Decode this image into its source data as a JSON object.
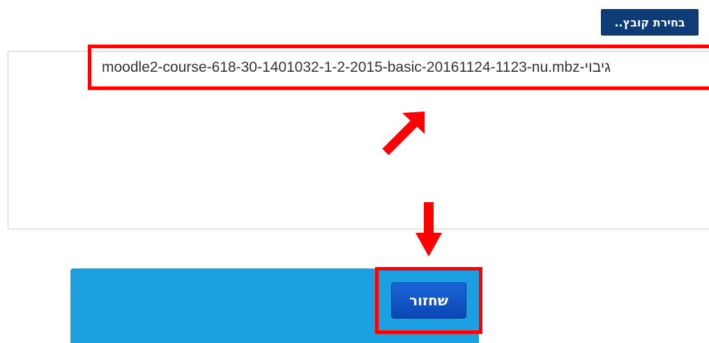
{
  "file_picker": {
    "choose_label": "בחירת קובץ..",
    "selected_file": "גיבוי-moodle2-course-618-30-1401032-1-2-2015-basic-20161124-1123-nu.mbz"
  },
  "actions": {
    "restore_label": "שחזור"
  },
  "colors": {
    "choose_button_bg": "#0f3c77",
    "panel_bg": "#1ba1e2",
    "restore_button_bg": "#0a46b4",
    "highlight": "#ff0000"
  },
  "annotations": {
    "diagonal_arrow_icon": "arrow-up-right-icon",
    "down_arrow_icon": "arrow-down-icon"
  }
}
